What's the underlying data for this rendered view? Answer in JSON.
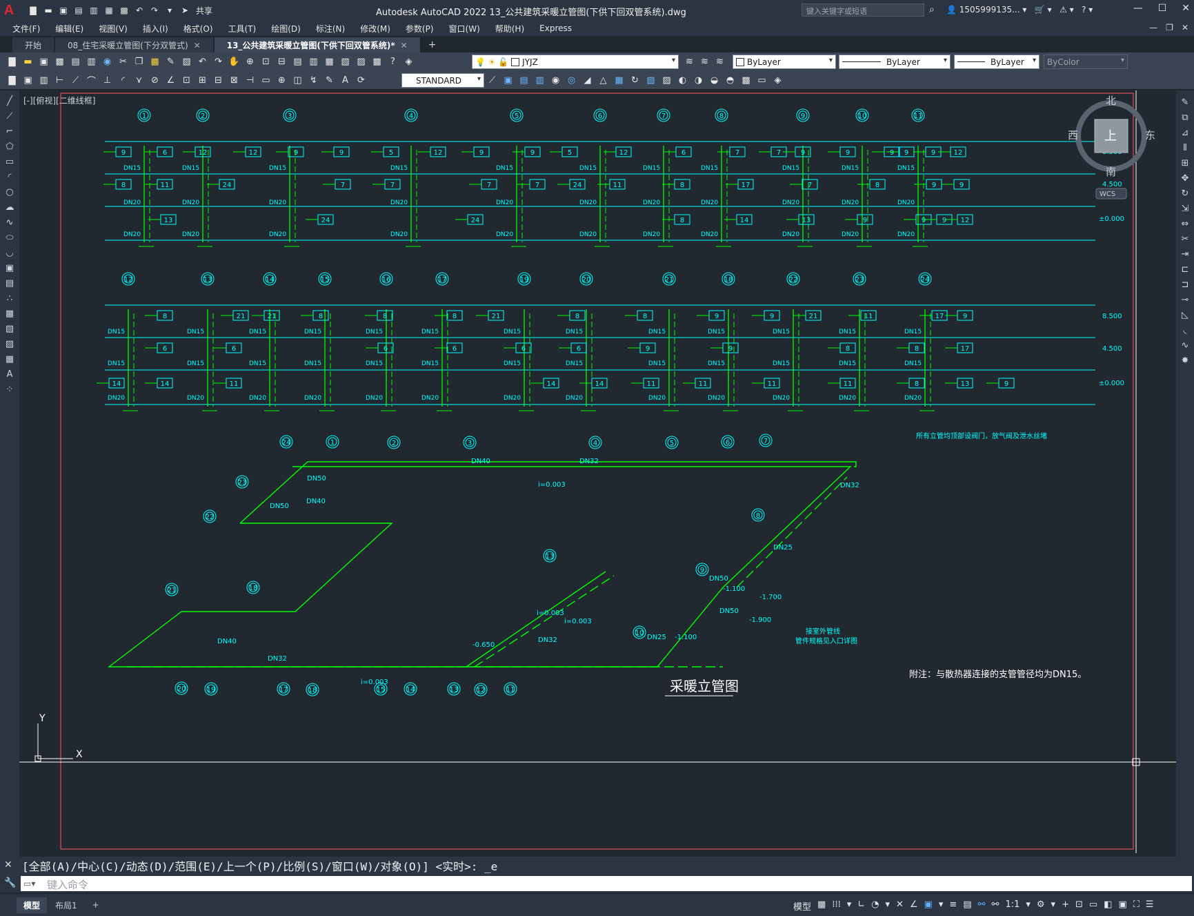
{
  "app": {
    "logo": "A",
    "window_title": "Autodesk AutoCAD 2022    13_公共建筑采暖立管图(下供下回双管系统).dwg",
    "search_placeholder": "键入关键字或短语",
    "user": "1505999135...",
    "share_label": "共享"
  },
  "menu": [
    "文件(F)",
    "编辑(E)",
    "视图(V)",
    "插入(I)",
    "格式(O)",
    "工具(T)",
    "绘图(D)",
    "标注(N)",
    "修改(M)",
    "参数(P)",
    "窗口(W)",
    "帮助(H)",
    "Express"
  ],
  "tabs": [
    {
      "label": "开始",
      "active": false,
      "closable": false
    },
    {
      "label": "08_住宅采暖立管图(下分双管式)",
      "active": false,
      "closable": true
    },
    {
      "label": "13_公共建筑采暖立管图(下供下回双管系统)*",
      "active": true,
      "closable": true
    }
  ],
  "toolbar": {
    "layer_name": "JYJZ",
    "color_combo": "ByLayer",
    "linetype_combo": "ByLayer",
    "lineweight_combo": "ByLayer",
    "plotstyle_combo": "ByColor",
    "textstyle_combo": "STANDARD"
  },
  "viewport": {
    "label": "[-][俯视][二维线框]",
    "compass": {
      "north": "北",
      "south": "南",
      "east": "东",
      "west": "西",
      "top": "上",
      "wcs": "WCS"
    },
    "ucs_y": "Y",
    "ucs_x": "X"
  },
  "drawing": {
    "colors": {
      "cyan": "#00ffff",
      "green": "#00ff00",
      "white": "#ffffff",
      "red": "#ff4444"
    },
    "row1_axes": [
      "1",
      "2",
      "3",
      "4",
      "5",
      "6",
      "7",
      "8",
      "9",
      "10",
      "11"
    ],
    "row2_axes": [
      "12",
      "13",
      "14",
      "15",
      "16",
      "17",
      "19",
      "20",
      "21",
      "18",
      "22",
      "23",
      "24"
    ],
    "levels": [
      "8.500",
      "4.500",
      "±0.000"
    ],
    "row1_top_boxes": [
      "9",
      "6",
      "12",
      "12",
      "9",
      "9",
      "5",
      "12",
      "9",
      "9",
      "5",
      "12",
      "6",
      "7",
      "7",
      "9",
      "9",
      "9",
      "9",
      "9",
      "12"
    ],
    "row1_mid_boxes": [
      "8",
      "11",
      "24",
      "7",
      "7",
      "7",
      "7",
      "24",
      "11",
      "8",
      "17",
      "7",
      "8",
      "9",
      "9"
    ],
    "row1_bot_boxes": [
      "13",
      "24",
      "24",
      "8",
      "14",
      "13",
      "9",
      "9",
      "9",
      "12"
    ],
    "row2_top_boxes": [
      "8",
      "21",
      "21",
      "8",
      "8",
      "8",
      "21",
      "8",
      "8",
      "9",
      "9",
      "21",
      "11",
      "17",
      "9"
    ],
    "row2_mid_boxes": [
      "6",
      "6",
      "6",
      "6",
      "6",
      "6",
      "9",
      "9",
      "8",
      "8",
      "17"
    ],
    "row2_bot_boxes": [
      "14",
      "14",
      "11",
      "14",
      "14",
      "11",
      "11",
      "11",
      "11",
      "8",
      "13",
      "9"
    ],
    "pipe_labels": [
      "DN15",
      "DN20",
      "DN15",
      "DN20",
      "DN15",
      "DN20"
    ],
    "plan_labels": [
      "DN40",
      "DN32",
      "DN50",
      "DN40",
      "DN50",
      "DN32",
      "DN25",
      "DN50",
      "DN40",
      "DN32",
      "DN50",
      "DN25",
      "DN32"
    ],
    "slopes": [
      "i=0.003",
      "i=0.003",
      "i=0.003",
      "i=0.003"
    ],
    "elevations": [
      "-1.100",
      "-1.700",
      "-1.900",
      "-1.100",
      "-0.650"
    ],
    "plan_circles_top": [
      "24",
      "1",
      "2",
      "3",
      "4",
      "5",
      "6",
      "7"
    ],
    "plan_circles_bottom": [
      "20",
      "19",
      "17",
      "18",
      "15",
      "14",
      "13",
      "12",
      "11"
    ],
    "plan_circles_other": [
      "23",
      "22",
      "21",
      "18",
      "13",
      "8",
      "9",
      "10"
    ],
    "note_riser": "所有立管均顶部设阀门，放气阀及泄水丝堵",
    "note_outdoor_1": "接室外管线",
    "note_outdoor_2": "管件规格见入口详图",
    "title": "采暖立管图",
    "footnote": "附注：与散热器连接的支管管径均为DN15。"
  },
  "command": {
    "history": "[全部(A)/中心(C)/动态(D)/范围(E)/上一个(P)/比例(S)/窗口(W)/对象(O)] <实时>: _e",
    "placeholder": "键入命令"
  },
  "status": {
    "layout_tabs": [
      "模型",
      "布局1"
    ],
    "model_label": "模型",
    "scale": "1:1"
  }
}
